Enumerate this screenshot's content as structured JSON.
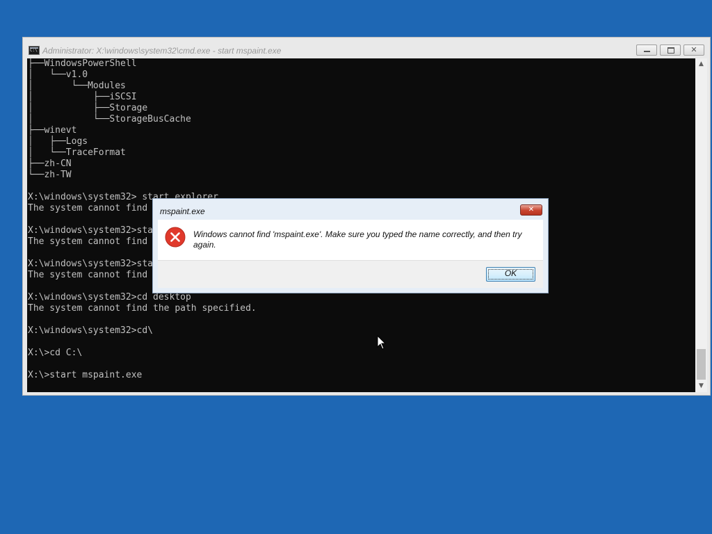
{
  "cmd_window": {
    "title": "Administrator: X:\\windows\\system32\\cmd.exe - start  mspaint.exe",
    "console_lines": [
      "├──WindowsPowerShell",
      "│   └──v1.0",
      "│       └──Modules",
      "│           ├──iSCSI",
      "│           ├──Storage",
      "│           └──StorageBusCache",
      "├──winevt",
      "│   ├──Logs",
      "│   └──TraceFormat",
      "├──zh-CN",
      "└──zh-TW",
      "",
      "X:\\windows\\system32> start explorer",
      "The system cannot find",
      "",
      "X:\\windows\\system32>sta",
      "The system cannot find",
      "",
      "X:\\windows\\system32>sta",
      "The system cannot find",
      "",
      "X:\\windows\\system32>cd desktop",
      "The system cannot find the path specified.",
      "",
      "X:\\windows\\system32>cd\\",
      "",
      "X:\\>cd C:\\",
      "",
      "X:\\>start mspaint.exe"
    ]
  },
  "dialog": {
    "title": "mspaint.exe",
    "message": "Windows cannot find 'mspaint.exe'. Make sure you typed the name correctly, and then try again.",
    "ok_label": "OK",
    "icon": "error-icon"
  },
  "colors": {
    "desktop": "#1e67b4",
    "console_bg": "#0c0c0c",
    "console_text": "#c0c0c0",
    "error_red": "#e0392b"
  }
}
